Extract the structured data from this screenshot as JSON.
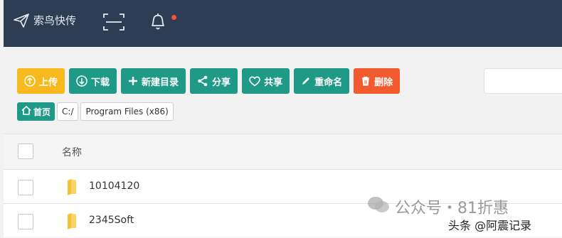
{
  "header": {
    "app_name": "索鸟快传",
    "icons": [
      "paper-plane-icon",
      "scan-icon",
      "bell-icon"
    ]
  },
  "toolbar": {
    "upload_label": "上传",
    "download_label": "下载",
    "new_dir_label": "新建目录",
    "share_label": "分享",
    "co_share_label": "共享",
    "rename_label": "重命名",
    "delete_label": "删除"
  },
  "colors": {
    "header_bg": "#2e3d54",
    "primary": "#1f9a86",
    "upload": "#f7ba1e",
    "delete": "#f15b2f",
    "notification_dot": "#f0553a"
  },
  "breadcrumb": {
    "home_label": "首页",
    "items": [
      "C:/",
      "Program Files (x86)"
    ]
  },
  "table": {
    "columns": [
      "名称"
    ],
    "rows": [
      {
        "name": "10104120"
      },
      {
        "name": "2345Soft"
      }
    ]
  },
  "watermark": {
    "main": "公众号・81折惠",
    "sub": "头条 @阿震记录"
  }
}
